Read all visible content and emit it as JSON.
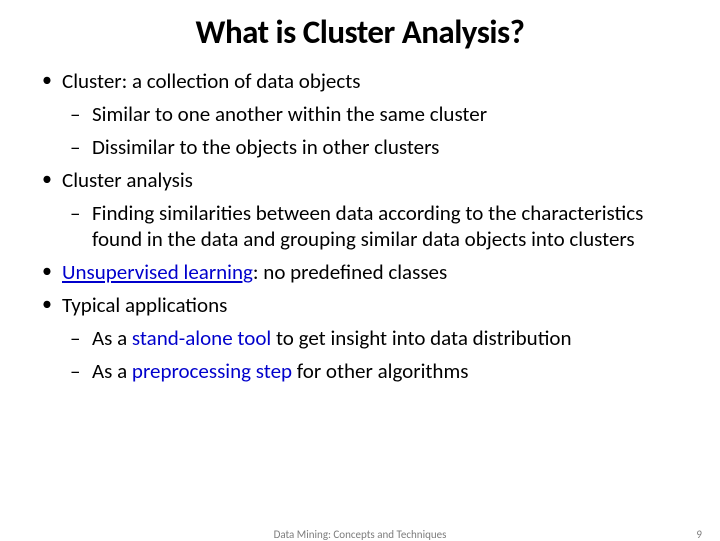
{
  "title": "What is Cluster Analysis?",
  "bullets": {
    "b1": "Cluster: a collection of data objects",
    "b1_1": "Similar to one another within the same cluster",
    "b1_2": "Dissimilar to the objects in other clusters",
    "b2": "Cluster analysis",
    "b2_1": "Finding similarities between data according to the characteristics found in the data and grouping similar data objects into clusters",
    "b3_pre": "",
    "b3_highlight": "Unsupervised learning",
    "b3_post": ": no predefined classes",
    "b4": "Typical applications",
    "b4_1_pre": "As a ",
    "b4_1_highlight": "stand-alone tool",
    "b4_1_post": " to get insight into data distribution",
    "b4_2_pre": "As a ",
    "b4_2_highlight": "preprocessing step",
    "b4_2_post": " for other algorithms"
  },
  "footer": {
    "center": "Data Mining: Concepts and Techniques",
    "page": "9"
  }
}
